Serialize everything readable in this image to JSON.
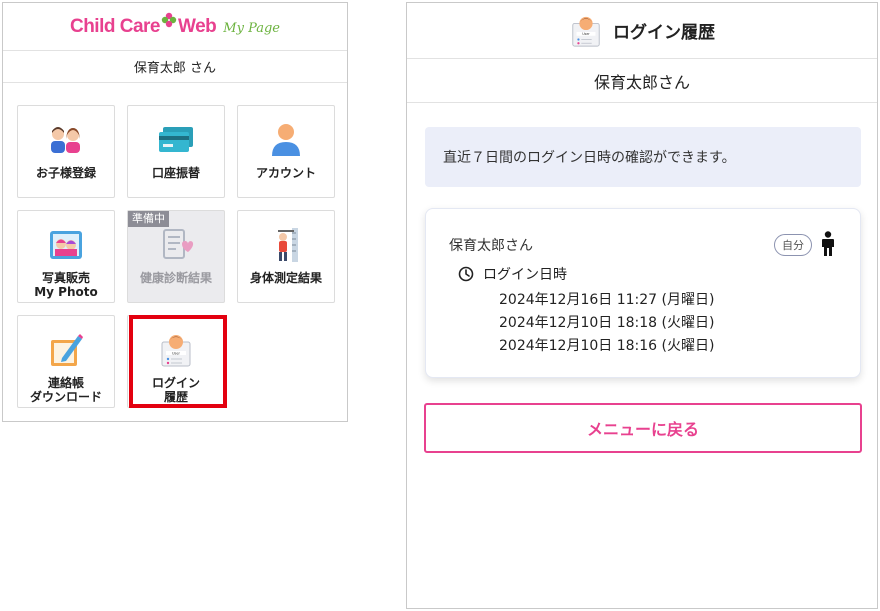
{
  "left": {
    "logo": {
      "main": "Child Care",
      "web": "Web",
      "sub": "My Page"
    },
    "user_name": "保育太郎 さん",
    "tiles": [
      {
        "label": "お子様登録",
        "icon": "children-icon"
      },
      {
        "label": "口座振替",
        "icon": "bank-card-icon"
      },
      {
        "label": "アカウント",
        "icon": "account-icon"
      },
      {
        "label": "写真販売\nMy Photo",
        "icon": "photo-icon"
      },
      {
        "label": "健康診断結果",
        "icon": "health-checkup-icon",
        "badge": "準備中",
        "disabled": true
      },
      {
        "label": "身体測定結果",
        "icon": "height-measure-icon"
      },
      {
        "label": "連絡帳\nダウンロード",
        "icon": "notebook-icon"
      },
      {
        "label": "ログイン\n履歴",
        "icon": "user-id-card-icon",
        "highlighted": true
      }
    ]
  },
  "right": {
    "title": "ログイン履歴",
    "user_name": "保育太郎さん",
    "notice": "直近７日間のログイン日時の確認ができます。",
    "card": {
      "name": "保育太郎さん",
      "badge": "自分",
      "login_label": "ログイン日時",
      "logins": [
        "2024年12月16日 11:27 (月曜日)",
        "2024年12月10日 18:18 (火曜日)",
        "2024年12月10日 18:16 (火曜日)"
      ]
    },
    "back_button": "メニューに戻る"
  },
  "colors": {
    "brand_pink": "#e8418f",
    "brand_green": "#6cb33f",
    "highlight_red": "#e3000f",
    "notice_bg": "#ebeef9"
  }
}
